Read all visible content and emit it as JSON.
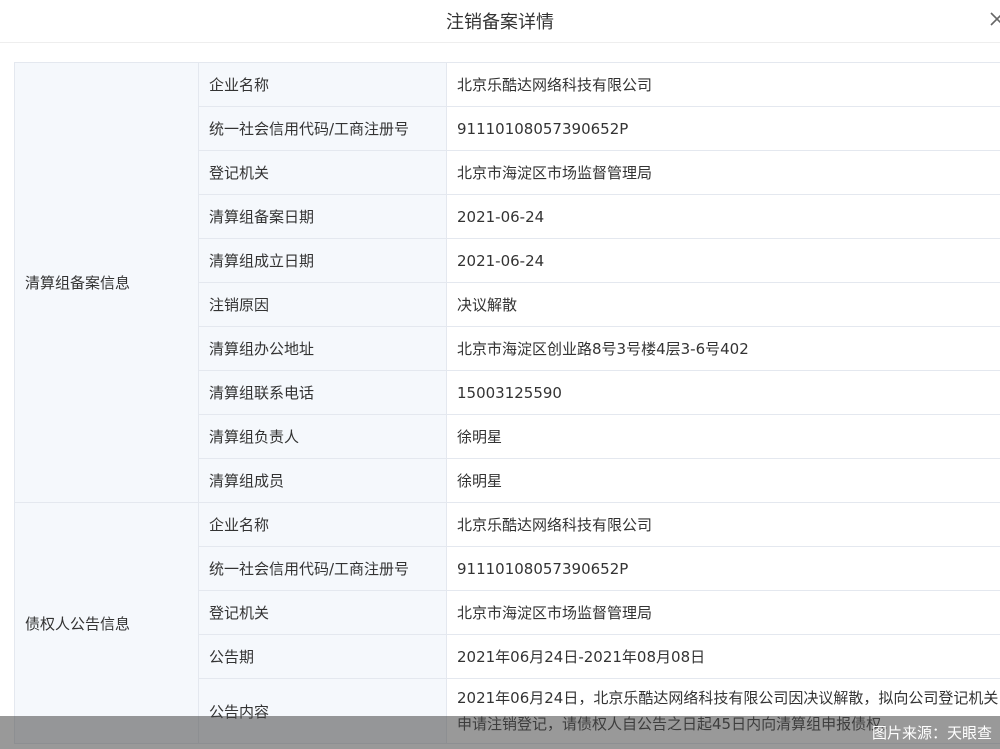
{
  "dialog": {
    "title": "注销备案详情",
    "close_icon": "close-icon"
  },
  "sections": [
    {
      "name": "清算组备案信息",
      "rows": [
        {
          "label": "企业名称",
          "value": "北京乐酷达网络科技有限公司"
        },
        {
          "label": "统一社会信用代码/工商注册号",
          "value": "91110108057390652P"
        },
        {
          "label": "登记机关",
          "value": "北京市海淀区市场监督管理局"
        },
        {
          "label": "清算组备案日期",
          "value": "2021-06-24"
        },
        {
          "label": "清算组成立日期",
          "value": "2021-06-24"
        },
        {
          "label": "注销原因",
          "value": "决议解散"
        },
        {
          "label": "清算组办公地址",
          "value": "北京市海淀区创业路8号3号楼4层3-6号402"
        },
        {
          "label": "清算组联系电话",
          "value": "15003125590"
        },
        {
          "label": "清算组负责人",
          "value": "徐明星"
        },
        {
          "label": "清算组成员",
          "value": "徐明星"
        }
      ]
    },
    {
      "name": "债权人公告信息",
      "rows": [
        {
          "label": "企业名称",
          "value": "北京乐酷达网络科技有限公司"
        },
        {
          "label": "统一社会信用代码/工商注册号",
          "value": "91110108057390652P"
        },
        {
          "label": "登记机关",
          "value": "北京市海淀区市场监督管理局"
        },
        {
          "label": "公告期",
          "value": "2021年06月24日-2021年08月08日"
        },
        {
          "label": "公告内容",
          "value": "2021年06月24日，北京乐酷达网络科技有限公司因决议解散，拟向公司登记机关申请注销登记，请债权人自公告之日起45日内向清算组申报债权。"
        }
      ]
    }
  ],
  "watermark": {
    "text": "图片来源：天眼查"
  }
}
